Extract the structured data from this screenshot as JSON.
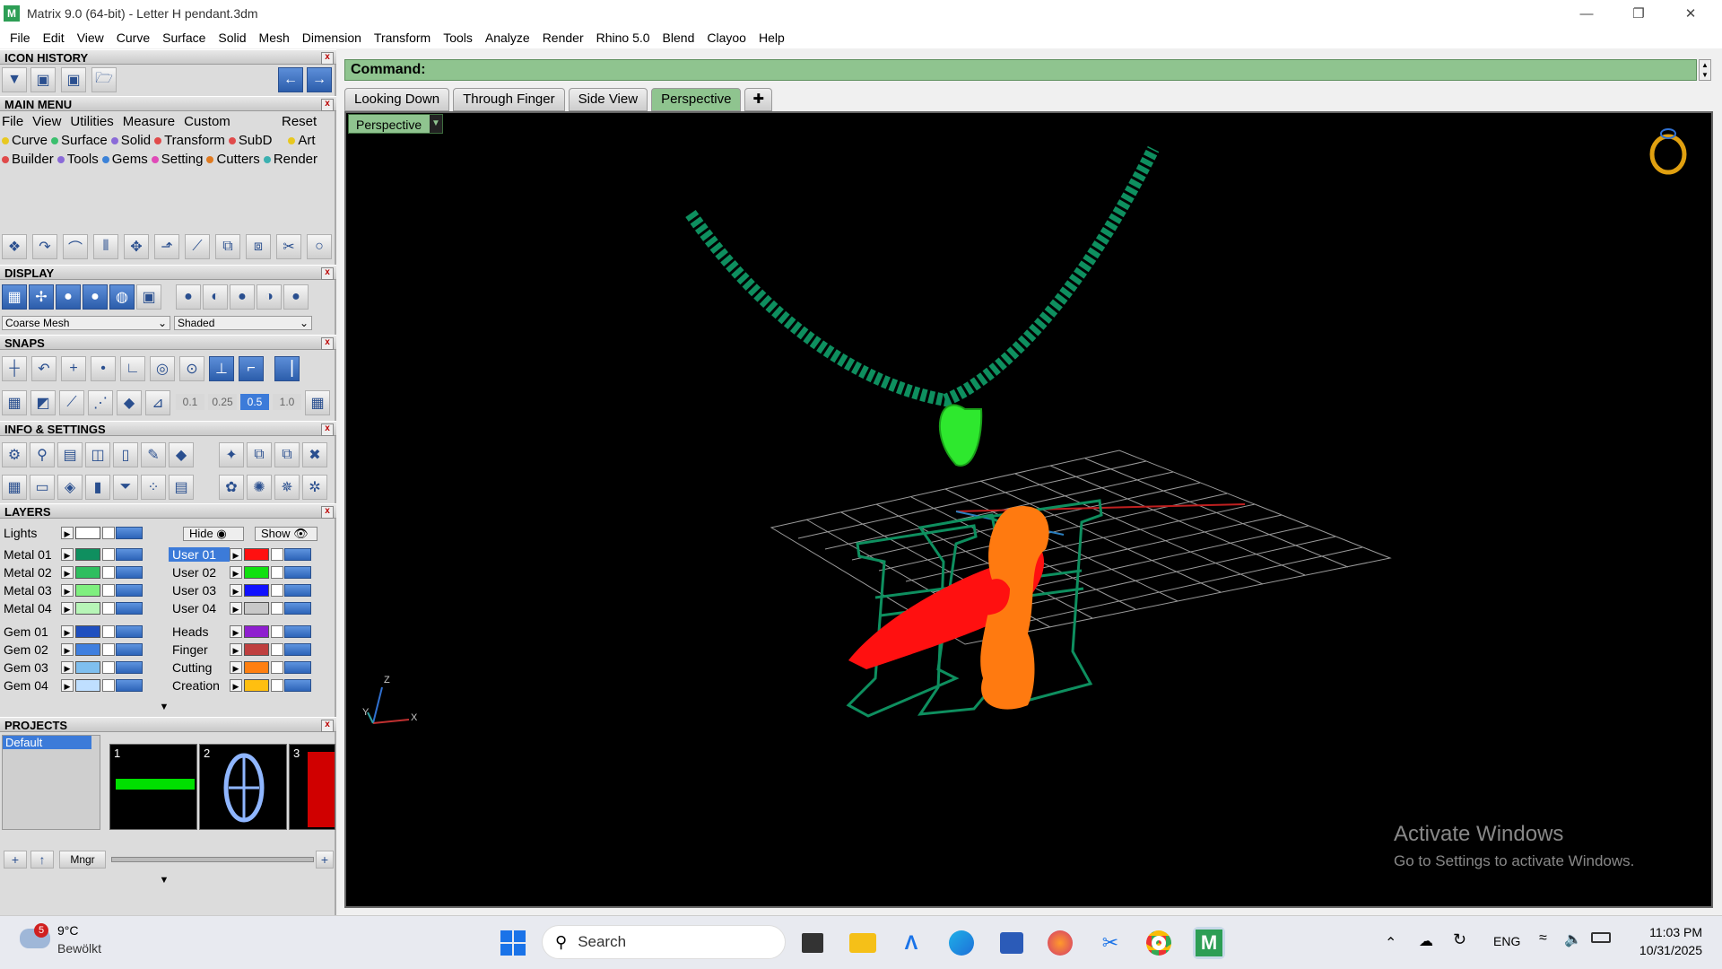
{
  "window": {
    "title": "Matrix 9.0 (64-bit) - Letter H pendant.3dm",
    "logo": "matrix-logo-icon"
  },
  "menubar": [
    "File",
    "Edit",
    "View",
    "Curve",
    "Surface",
    "Solid",
    "Mesh",
    "Dimension",
    "Transform",
    "Tools",
    "Analyze",
    "Render",
    "Rhino 5.0",
    "Blend",
    "Clayoo",
    "Help"
  ],
  "panels": {
    "icon_history": "ICON HISTORY",
    "main_menu": "MAIN MENU",
    "display": "DISPLAY",
    "snaps": "SNAPS",
    "info": "INFO & SETTINGS",
    "layers": "LAYERS",
    "projects": "PROJECTS"
  },
  "main_menu": {
    "top": [
      "File",
      "View",
      "Utilities",
      "Measure",
      "Custom"
    ],
    "reset": "Reset",
    "row1": [
      {
        "label": "Curve",
        "color": "#e8c820"
      },
      {
        "label": "Surface",
        "color": "#3bbf6e"
      },
      {
        "label": "Solid",
        "color": "#8a6ad8"
      },
      {
        "label": "Transform",
        "color": "#e04a4a"
      },
      {
        "label": "SubD",
        "color": "#e04a4a"
      },
      {
        "label": "Art",
        "color": "#e8c820"
      }
    ],
    "row2": [
      {
        "label": "Builder",
        "color": "#e04a4a"
      },
      {
        "label": "Tools",
        "color": "#8a6ad8"
      },
      {
        "label": "Gems",
        "color": "#3b82d8"
      },
      {
        "label": "Setting",
        "color": "#e04ab8"
      },
      {
        "label": "Cutters",
        "color": "#e07a20"
      },
      {
        "label": "Render",
        "color": "#3bb0b0"
      }
    ]
  },
  "display": {
    "mesh": "Coarse Mesh",
    "shade": "Shaded"
  },
  "snaps": {
    "values": [
      "0.1",
      "0.25",
      "0.5",
      "1.0"
    ]
  },
  "layers": {
    "lights": "Lights",
    "hide": "Hide",
    "show": "Show",
    "left": [
      {
        "name": "Metal 01",
        "color": "#0f8f5f"
      },
      {
        "name": "Metal 02",
        "color": "#2fbf5f"
      },
      {
        "name": "Metal 03",
        "color": "#7fef7f"
      },
      {
        "name": "Metal 04",
        "color": "#b7f5b7"
      },
      {
        "name": "Gem 01",
        "color": "#1f4fbf"
      },
      {
        "name": "Gem 02",
        "color": "#3f7fdf"
      },
      {
        "name": "Gem 03",
        "color": "#7fbfef"
      },
      {
        "name": "Gem 04",
        "color": "#bfdfff"
      }
    ],
    "right": [
      {
        "name": "User 01",
        "color": "#ff1010"
      },
      {
        "name": "User 02",
        "color": "#10e010"
      },
      {
        "name": "User 03",
        "color": "#1010ff"
      },
      {
        "name": "User 04",
        "color": "#c8c8c8"
      },
      {
        "name": "Heads",
        "color": "#8f1fcf"
      },
      {
        "name": "Finger",
        "color": "#bf3f3f"
      },
      {
        "name": "Cutting",
        "color": "#ff7f10"
      },
      {
        "name": "Creation",
        "color": "#ffbf10"
      }
    ]
  },
  "projects": {
    "default": "Default",
    "numbers": [
      "1",
      "2",
      "3"
    ],
    "mngr": "Mngr"
  },
  "command": {
    "label": "Command:"
  },
  "tabs": [
    "Looking Down",
    "Through Finger",
    "Side View",
    "Perspective"
  ],
  "viewport": {
    "label": "Perspective",
    "axes": {
      "z": "Z",
      "y": "Y",
      "x": "X"
    }
  },
  "watermark": {
    "line1": "Activate Windows",
    "line2": "Go to Settings to activate Windows."
  },
  "taskbar": {
    "weather": {
      "temp": "9°C",
      "desc": "Bewölkt",
      "badge": "5"
    },
    "search": "Search",
    "lang": "ENG",
    "time": "11:03 PM",
    "date": "10/31/2025"
  }
}
